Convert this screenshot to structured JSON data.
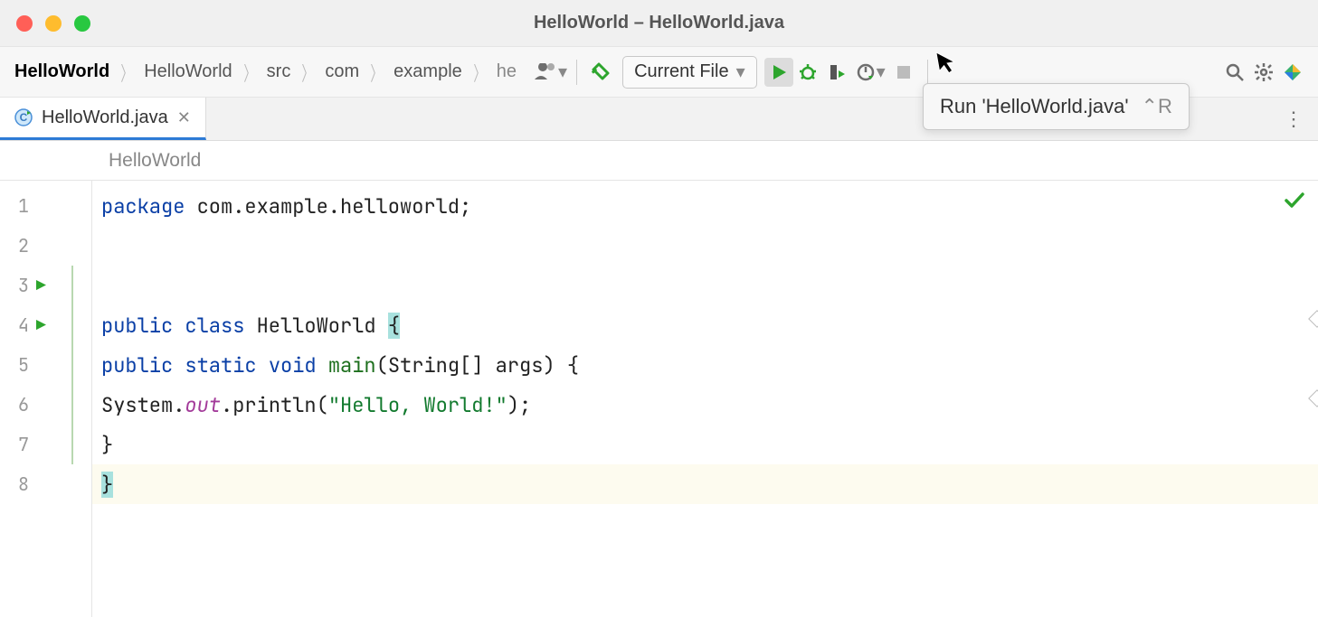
{
  "window": {
    "title": "HelloWorld – HelloWorld.java"
  },
  "breadcrumbs": {
    "root": "HelloWorld",
    "items": [
      "HelloWorld",
      "src",
      "com",
      "example",
      "he"
    ]
  },
  "toolbar": {
    "run_config": "Current File",
    "tooltip_label": "Run 'HelloWorld.java'",
    "tooltip_shortcut": "⌃R"
  },
  "tab": {
    "filename": "HelloWorld.java"
  },
  "context": {
    "class": "HelloWorld"
  },
  "code": {
    "lines": [
      {
        "n": "1",
        "tokens": [
          {
            "t": "package ",
            "c": "kw"
          },
          {
            "t": "com.example.helloworld",
            "c": "id"
          },
          {
            "t": ";",
            "c": "punc"
          }
        ]
      },
      {
        "n": "2",
        "tokens": []
      },
      {
        "n": "3",
        "run": true,
        "tokens": [
          {
            "t": "public class ",
            "c": "kw"
          },
          {
            "t": "HelloWorld ",
            "c": "id"
          },
          {
            "t": "{",
            "c": "punc",
            "hl": true
          }
        ]
      },
      {
        "n": "4",
        "run": true,
        "indent": "    ",
        "tokens": [
          {
            "t": "public static ",
            "c": "kw"
          },
          {
            "t": "void ",
            "c": "kw"
          },
          {
            "t": "main",
            "c": "fn"
          },
          {
            "t": "(String[] args) {",
            "c": "punc"
          }
        ]
      },
      {
        "n": "5",
        "indent": "        ",
        "tokens": [
          {
            "t": "System.",
            "c": "id"
          },
          {
            "t": "out",
            "c": "fld"
          },
          {
            "t": ".println(",
            "c": "id"
          },
          {
            "t": "\"Hello, World!\"",
            "c": "str"
          },
          {
            "t": ");",
            "c": "punc"
          }
        ]
      },
      {
        "n": "6",
        "indent": "    ",
        "tokens": [
          {
            "t": "}",
            "c": "punc"
          }
        ]
      },
      {
        "n": "7",
        "hl": true,
        "tokens": [
          {
            "t": "}",
            "c": "punc",
            "hl": true
          }
        ]
      },
      {
        "n": "8",
        "tokens": []
      }
    ]
  }
}
